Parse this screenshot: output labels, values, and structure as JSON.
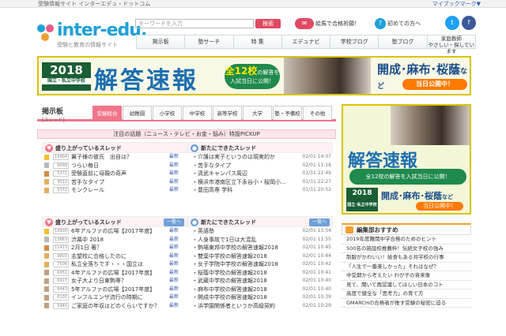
{
  "topbar": {
    "left": "受験情報サイト インターエデュ・ドットコム",
    "right": "マイブックマーク▼"
  },
  "logo": {
    "name": "inter-edu.",
    "tagline": "受験と教育の情報サイト"
  },
  "search": {
    "placeholder": "キーワードを入力",
    "button": "検索"
  },
  "tools": {
    "weekly": "絵馬で合格祈願！",
    "first": "初めての方へ"
  },
  "nav": [
    "掲示板",
    "塾サーチ",
    "特 集",
    "エデュナビ",
    "学校ブログ",
    "塾ブログ",
    "家庭教師"
  ],
  "nav_sub": "やさしい・探しています",
  "banner": {
    "year": "2018",
    "year_sub": "年度版",
    "year_label": "国立・私立中学校",
    "title": "解答速報",
    "pill_top": "全12校",
    "pill_mid": "の解答を",
    "pill_bottom": "入試当日に公開！",
    "schools": "開成･麻布･桜蔭",
    "suffix": "など",
    "now": "当日公開中！"
  },
  "bbs": {
    "title": "掲示板",
    "sub": "[スレッド]",
    "tabs": [
      "受験総合",
      "幼稚園",
      "小学校",
      "中学校",
      "高等学校",
      "大学",
      "塾・予備校",
      "その他"
    ],
    "topic": "注目の話題（ニュース・テレビ・お金・悩み）特設PICKUP",
    "hot_title": "盛り上がっているスレッド",
    "new_title": "新たにできたスレッド",
    "more": "一覧へ",
    "new_label": "最新",
    "hot1": [
      {
        "c": "19904",
        "t": "翼子様の彼氏　出自は？"
      },
      {
        "c": "9099",
        "t": "つらい毎日"
      },
      {
        "c": "5372",
        "t": "受験直前に母親の奇声"
      },
      {
        "c": "4512",
        "t": "苦手なタイプ"
      },
      {
        "c": "5372",
        "t": "モンクレール"
      }
    ],
    "new1": [
      {
        "t": "介護は実子というのは現実的か",
        "d": "02/01 14:07"
      },
      {
        "t": "苦手なタイプ",
        "d": "02/01 11:18"
      },
      {
        "t": "清武キャンパス周辺",
        "d": "01/31 22:49"
      },
      {
        "t": "横浜市港南区立下永谷小・桜岡小…",
        "d": "01/31 22:27"
      },
      {
        "t": "豊田高専 学科",
        "d": "01/31 20:52"
      }
    ],
    "hot2": [
      {
        "c": "19930",
        "t": "6年アルファの広場【2017年度】"
      },
      {
        "c": "13663",
        "t": "渋幕中 2018"
      },
      {
        "c": "11423",
        "t": "2月1日 著？"
      },
      {
        "c": "9803",
        "t": "志望校に合格したのに"
      },
      {
        "c": "7506",
        "t": "私立全落ちです・・・国立は"
      },
      {
        "c": "6051",
        "t": "4年アルファの広場【2017年度】"
      },
      {
        "c": "6917",
        "t": "女子大より日東駒専？"
      },
      {
        "c": "6443",
        "t": "5年アルファの広場【2017年度】"
      },
      {
        "c": "6102",
        "t": "インフルエンザ流行の時期に"
      },
      {
        "c": "5940",
        "t": "ご家庭の年収はどのくらいですか？"
      }
    ],
    "new2": [
      {
        "t": "英語塾",
        "d": "02/01 13:54"
      },
      {
        "t": "人身事故で1日は大混乱",
        "d": "02/01 11:55"
      },
      {
        "t": "駒場東邦中学校の解答速報2018",
        "d": "02/01 10:45"
      },
      {
        "t": "雙葉中学校の解答速報2018",
        "d": "02/01 10:44"
      },
      {
        "t": "女子学院中学校の解答速報2018",
        "d": "02/01 10:42"
      },
      {
        "t": "桜蔭中学校の解答速報2018",
        "d": "02/01 10:41"
      },
      {
        "t": "武蔵中学校の解答速報2018",
        "d": "02/01 10:40"
      },
      {
        "t": "麻布中学校の解答速報2018",
        "d": "02/01 10:40"
      },
      {
        "t": "開成中学校の解答速報2018",
        "d": "02/01 10:39"
      },
      {
        "t": "浜学園関係者というか高級契約",
        "d": "02/01 10:29"
      }
    ]
  },
  "side": {
    "title": "解答速報",
    "pill": "全12校の解答を入試当日に公開！",
    "year": "2018",
    "year_sub": "国立･私立中学校",
    "schools": "開成･麻布･桜蔭",
    "suffix": "など",
    "now": "当日公開中！"
  },
  "rec": {
    "title": "編集部おすすめ",
    "items": [
      "2019年度難関中学合格のためのヒント",
      "500名の施設校推薦枠！伝統女子校の強み",
      "制服がかわいい！給食もある共学校の行事",
      "「人生で一番楽しかった」それはなぜ？",
      "中受期から考えたい わが子の将来像",
      "見て、聞いて再認識してほしい日本のコト",
      "高度で健全な「思考力」の育て方",
      "GMARCHの合格者が推す受験の秘密に迫る"
    ]
  },
  "colors": {
    "accent": "#f0758a",
    "brand": "#1fa0d8",
    "banner_border": "#d9c400"
  }
}
